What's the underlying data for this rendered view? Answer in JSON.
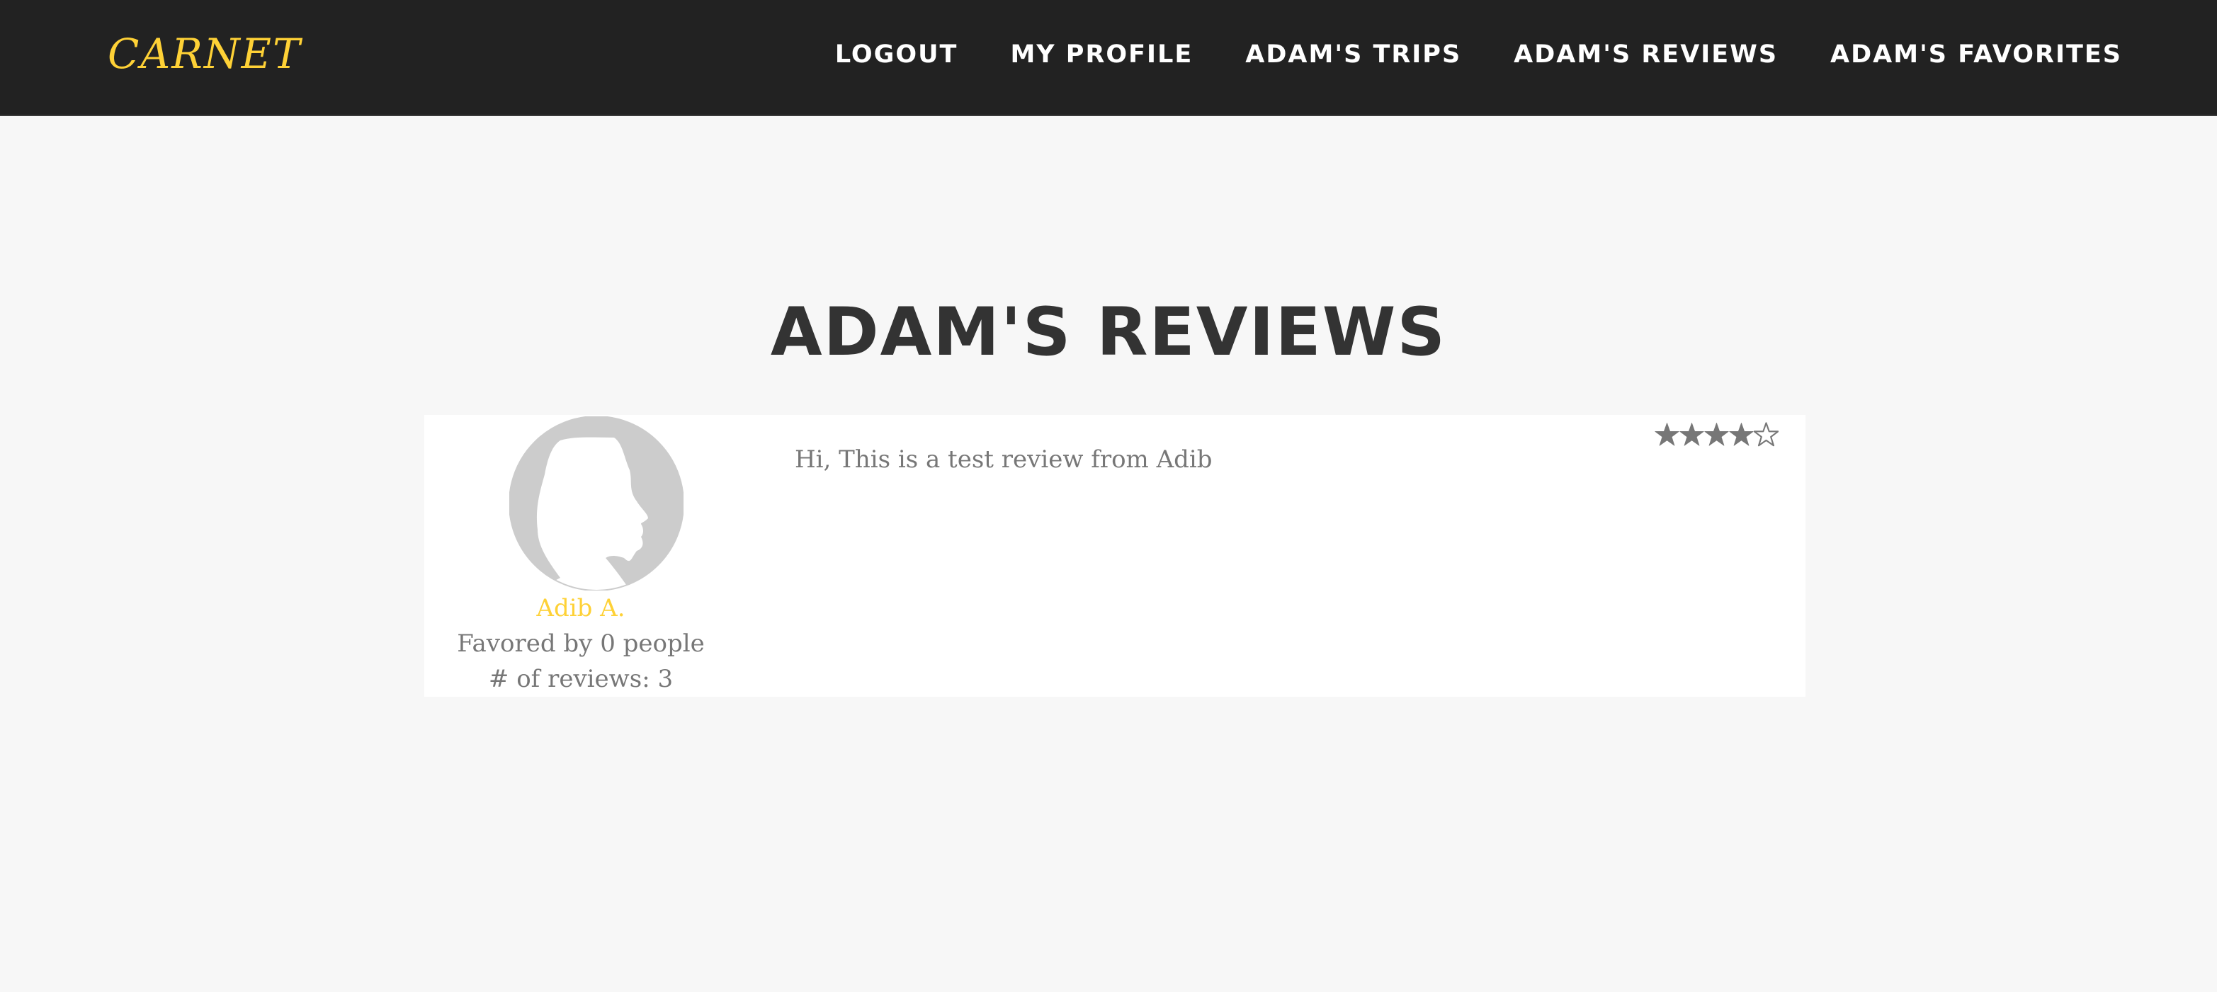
{
  "navbar": {
    "brand": "CARNET",
    "links": [
      {
        "label": "LOGOUT"
      },
      {
        "label": "MY PROFILE"
      },
      {
        "label": "ADAM'S TRIPS"
      },
      {
        "label": "ADAM'S REVIEWS"
      },
      {
        "label": "ADAM'S FAVORITES"
      }
    ]
  },
  "page": {
    "title": "ADAM'S REVIEWS"
  },
  "reviews": [
    {
      "reviewer": {
        "avatar_icon": "user-silhouette-icon",
        "name": "Adib A.",
        "favored": "Favored by 0 people",
        "review_count": "# of reviews: 3"
      },
      "text": "Hi, This is a test review from Adib",
      "rating": 4,
      "rating_max": 5
    }
  ],
  "colors": {
    "navbar_bg": "#222222",
    "brand_accent": "#fed136",
    "page_bg": "#f7f7f7",
    "card_bg": "#ffffff",
    "text_muted": "#777777",
    "title": "#333333",
    "avatar_gray": "#cccccc"
  }
}
